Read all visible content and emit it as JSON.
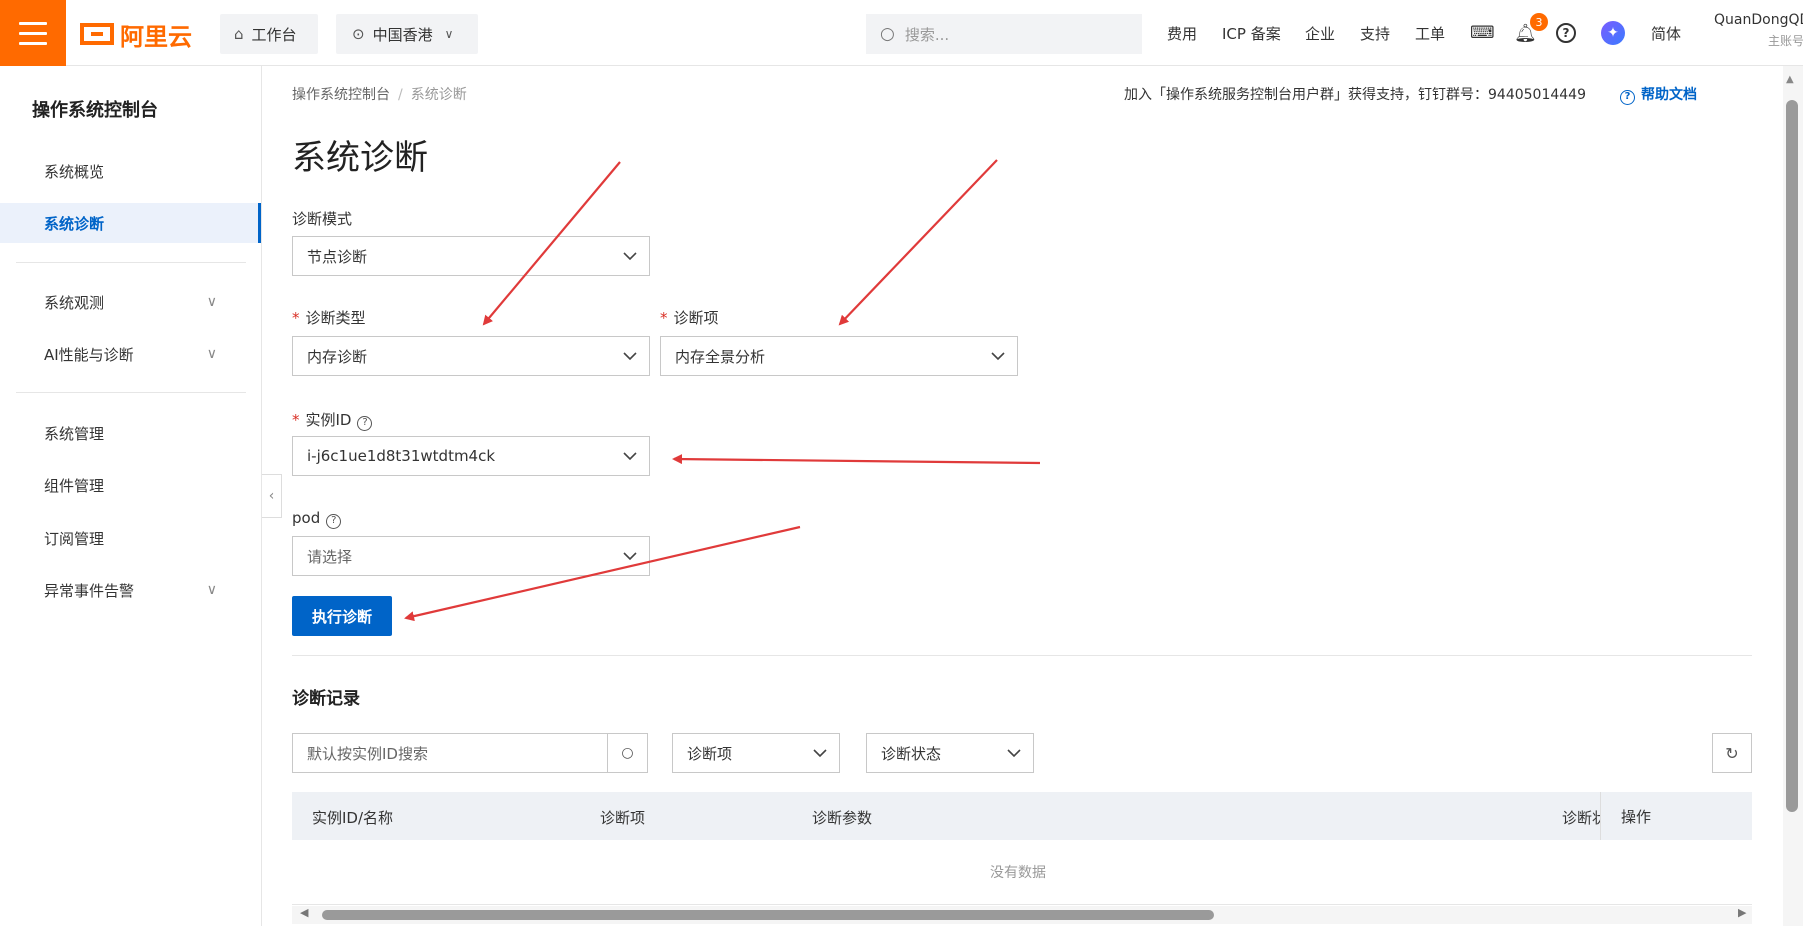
{
  "topbar": {
    "logo_text": "阿里云",
    "workbench": "工作台",
    "region": "中国香港",
    "search_placeholder": "搜索...",
    "nav": [
      "费用",
      "ICP 备案",
      "企业",
      "支持",
      "工单"
    ],
    "notification_count": "3",
    "lang": "简体",
    "user_name": "QuanDongQD",
    "user_role": "主账号",
    "accent_color": "#ff6a00"
  },
  "sidebar": {
    "title": "操作系统控制台",
    "items": [
      {
        "label": "系统概览"
      },
      {
        "label": "系统诊断",
        "active": true
      },
      {
        "label": "系统观测",
        "expandable": true
      },
      {
        "label": "AI性能与诊断",
        "expandable": true
      },
      {
        "label": "系统管理"
      },
      {
        "label": "组件管理"
      },
      {
        "label": "订阅管理"
      },
      {
        "label": "异常事件告警",
        "expandable": true
      }
    ]
  },
  "breadcrumb": {
    "root": "操作系统控制台",
    "current": "系统诊断"
  },
  "notice": "加入「操作系统服务控制台用户群」获得支持，钉钉群号：94405014449",
  "help_link": "帮助文档",
  "page_title": "系统诊断",
  "form": {
    "mode_label": "诊断模式",
    "mode_value": "节点诊断",
    "type_label": "诊断类型",
    "type_value": "内存诊断",
    "item_label": "诊断项",
    "item_value": "内存全景分析",
    "instance_label": "实例ID",
    "instance_value": "i-j6c1ue1d8t31wtdtm4ck",
    "pod_label": "pod",
    "pod_placeholder": "请选择",
    "submit": "执行诊断"
  },
  "records": {
    "title": "诊断记录",
    "search_placeholder": "默认按实例ID搜索",
    "filter_item": "诊断项",
    "filter_status": "诊断状态",
    "columns": [
      "实例ID/名称",
      "诊断项",
      "诊断参数",
      "诊断状",
      "操作"
    ],
    "empty_text": "没有数据"
  },
  "primary_color": "#0064c8",
  "annotation_color": "#e03a3a"
}
